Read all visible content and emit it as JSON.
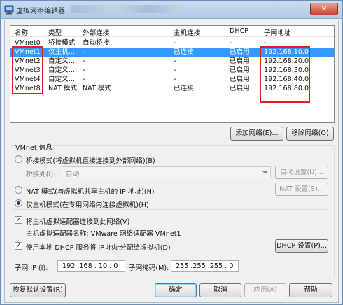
{
  "window": {
    "title": "虚拟网络编辑器",
    "close_label": "✕"
  },
  "list": {
    "headers": [
      "名称",
      "类型",
      "外部连接",
      "主机连接",
      "DHCP",
      "子网地址"
    ],
    "rows": [
      [
        "VMnet0",
        "桥接模式",
        "自动桥接",
        "-",
        "-",
        "-"
      ],
      [
        "VMnet1",
        "仅主机...",
        "-",
        "已连接",
        "已启用",
        "192.168.10.0"
      ],
      [
        "VMnet2",
        "自定义...",
        "-",
        "-",
        "已启用",
        "192.168.20.0"
      ],
      [
        "VMnet3",
        "自定义...",
        "-",
        "-",
        "已启用",
        "192.168.30.0"
      ],
      [
        "VMnet4",
        "自定义...",
        "-",
        "-",
        "已启用",
        "192.168.40.0"
      ],
      [
        "VMnet8",
        "NAT 模式",
        "NAT 模式",
        "已连接",
        "已启用",
        "192.168.80.0"
      ]
    ],
    "selected_index": 1
  },
  "buttons": {
    "add_network": "添加网络(E)...",
    "remove_network": "移除网络(O)",
    "auto_settings": "自动设置(U)...",
    "nat_settings": "NAT 设置(S)...",
    "dhcp_settings": "DHCP 设置(P)...",
    "restore_defaults": "恢复默认设置(R)",
    "ok": "确定",
    "cancel": "取消",
    "apply": "应用(A)",
    "help": "帮助"
  },
  "vmnet_info": {
    "group_title": "VMnet 信息",
    "bridged_label": "桥接模式(将虚拟机直接连接到外部网络)(B)",
    "bridged_to_label": "桥接到(I):",
    "bridged_to_value": "自动",
    "nat_label": "NAT 模式(与虚拟机共享主机的 IP 地址)(N)",
    "host_only_label": "仅主机模式(在专用网络内连接虚拟机)(H)",
    "selected_mode": "host_only",
    "connect_adapter_label": "将主机虚拟适配器连接到此网络(V)",
    "connect_adapter_checked": true,
    "adapter_name_label": "主机虚拟适配器名称: VMware 网络适配器 VMnet1",
    "dhcp_label": "使用本地 DHCP 服务将 IP 地址分配给虚拟机(D)",
    "dhcp_checked": true
  },
  "subnet": {
    "ip_label": "子网 IP (I):",
    "ip_value": "192 .168 . 10 . 0",
    "mask_label": "子网掩码(M):",
    "mask_value": "255 .255 .255 . 0"
  },
  "colors": {
    "selection": "#3399ff",
    "highlight_box": "#e02020"
  }
}
